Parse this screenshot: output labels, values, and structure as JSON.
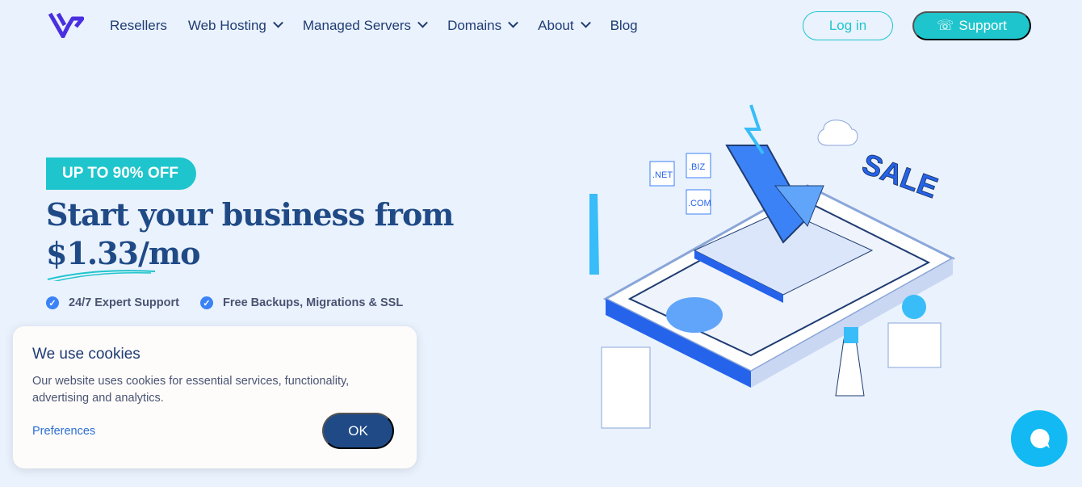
{
  "nav": {
    "items": [
      {
        "label": "Resellers",
        "dropdown": false
      },
      {
        "label": "Web Hosting",
        "dropdown": true
      },
      {
        "label": "Managed Servers",
        "dropdown": true
      },
      {
        "label": "Domains",
        "dropdown": true
      },
      {
        "label": "About",
        "dropdown": true
      },
      {
        "label": "Blog",
        "dropdown": false
      }
    ],
    "login": "Log in",
    "support": "Support"
  },
  "hero": {
    "badge": "UP TO 90% OFF",
    "title_line1": "Start your business from",
    "title_line2": "$1.33/mo",
    "features": [
      "24/7 Expert Support",
      "Free Backups, Migrations & SSL"
    ]
  },
  "illustration": {
    "tags": [
      ".NET",
      ".BIZ",
      ".COM"
    ],
    "sale": "SALE"
  },
  "cookie": {
    "title": "We use cookies",
    "text": "Our website uses cookies for essential services, functionality, advertising and analytics.",
    "preferences": "Preferences",
    "ok": "OK"
  },
  "colors": {
    "accent": "#1fc5cc",
    "primary": "#1f4a86",
    "logo": "#4a2fe0",
    "chat": "#12b9f3",
    "background": "#eaf2fe"
  }
}
